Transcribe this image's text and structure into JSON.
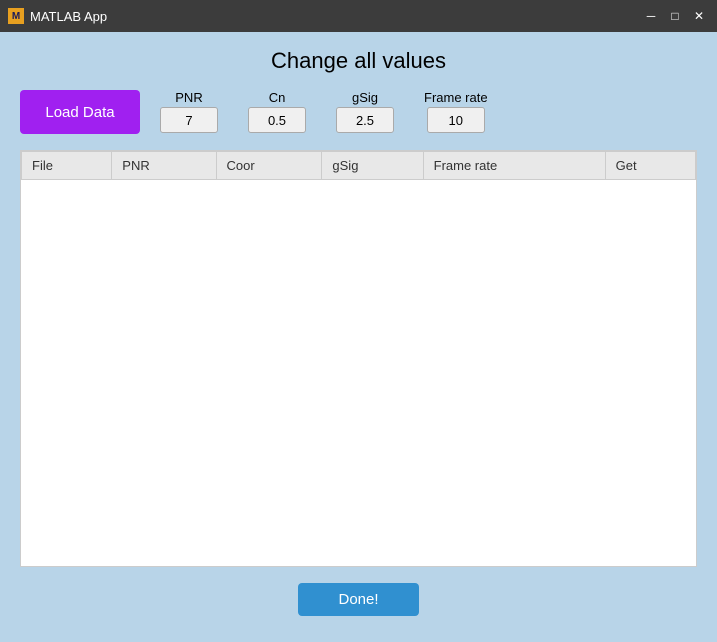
{
  "titleBar": {
    "appName": "MATLAB App",
    "minimizeLabel": "─",
    "maximizeLabel": "□",
    "closeLabel": "✕"
  },
  "main": {
    "title": "Change all values",
    "loadDataLabel": "Load Data",
    "params": [
      {
        "label": "PNR",
        "value": "7"
      },
      {
        "label": "Cn",
        "value": "0.5"
      },
      {
        "label": "gSig",
        "value": "2.5"
      },
      {
        "label": "Frame rate",
        "value": "10"
      }
    ],
    "table": {
      "columns": [
        "File",
        "PNR",
        "Coor",
        "gSig",
        "Frame rate",
        "Get"
      ],
      "rows": []
    },
    "doneLabel": "Done!"
  }
}
